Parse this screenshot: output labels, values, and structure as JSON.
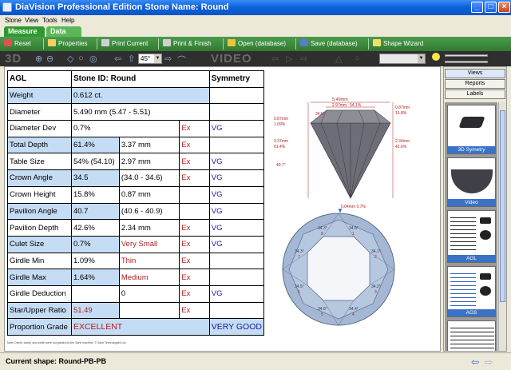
{
  "window": {
    "title": "DiaVision Professional Edition Stone Name: Round"
  },
  "menu": [
    "Stone",
    "View",
    "Tools",
    "Help"
  ],
  "tabs": [
    "Measure",
    "Data"
  ],
  "toolbar": {
    "reset": "Reset",
    "properties": "Properties",
    "print_current": "Print Current",
    "print_finish": "Print & Finish",
    "open_database": "Open (database)",
    "save_database": "Save (database)",
    "shape_wizard": "Shape Wizard"
  },
  "view_bar": {
    "label_3d": "3D",
    "label_video": "VIDEO",
    "angle": "45°"
  },
  "report": {
    "lab": "AGL",
    "stone_id": "Stone ID: Round",
    "symmetry_header": "Symmetry",
    "rows": [
      {
        "label": "Weight",
        "value": "0.612 ct.",
        "detail": "",
        "grade": "",
        "symmetry": ""
      },
      {
        "label": "Diameter",
        "value": "5.490 mm (5.47 - 5.51)",
        "detail": "",
        "grade": "",
        "symmetry": ""
      },
      {
        "label": "Diameter Dev",
        "value": "0.7%",
        "detail": "",
        "grade": "Ex",
        "symmetry": "VG"
      },
      {
        "label": "Total Depth",
        "value": "61.4%",
        "detail": "3.37 mm",
        "grade": "Ex",
        "symmetry": ""
      },
      {
        "label": "Table Size",
        "value": "54% (54.10)",
        "detail": "2.97 mm",
        "grade": "Ex",
        "symmetry": "VG"
      },
      {
        "label": "Crown Angle",
        "value": "34.5",
        "detail": "(34.0 - 34.6)",
        "grade": "Ex",
        "symmetry": "VG"
      },
      {
        "label": "Crown Height",
        "value": "15.8%",
        "detail": "0.87 mm",
        "grade": "",
        "symmetry": "VG"
      },
      {
        "label": "Pavilion Angle",
        "value": "40.7",
        "detail": "(40.6 - 40.9)",
        "grade": "",
        "symmetry": "VG"
      },
      {
        "label": "Pavilion Depth",
        "value": "42.6%",
        "detail": "2.34 mm",
        "grade": "Ex",
        "symmetry": "VG"
      },
      {
        "label": "Culet Size",
        "value": "0.7%",
        "detail": "Very Small",
        "grade": "Ex",
        "symmetry": "VG"
      },
      {
        "label": "Girdle Min",
        "value": "1.09%",
        "detail": "Thin",
        "grade": "Ex",
        "symmetry": ""
      },
      {
        "label": "Girdle Max",
        "value": "1.64%",
        "detail": "Medium",
        "grade": "Ex",
        "symmetry": ""
      },
      {
        "label": "Girdle Deduction",
        "value": "",
        "detail": "0",
        "grade": "Ex",
        "symmetry": "VG"
      },
      {
        "label": "Star/Upper Ratio",
        "value": "51.49",
        "detail": "",
        "grade": "Ex",
        "symmetry": ""
      },
      {
        "label": "Proportion Grade",
        "value": "EXCELLENT",
        "detail": "",
        "grade": "",
        "symmetry": "VERY GOOD"
      }
    ],
    "footnote": "Note: Depth, clarity, and polish were not graded by the Sarin machine. © Sarin Technologies Ltd."
  },
  "profile": {
    "width": "5.49mm",
    "table": "2.97mm",
    "table_pct": "54.1%",
    "crown_angle": "34.5°",
    "crown_height_mm": "0.87mm",
    "crown_height_pct": "15.8%",
    "crown_left_mm": "0.87mm",
    "crown_left_pct": "1.09%",
    "depth_mm": "3.37mm",
    "depth_pct": "61.4%",
    "pav_depth_mm": "2.34mm",
    "pav_depth_pct": "42.6%",
    "pav_angle": "40.7°",
    "culet": "0.04mm 0.7%"
  },
  "top_view": {
    "crown_angles": [
      "34.3°",
      "34.6°",
      "34.1°",
      "34.2°",
      "34.4°",
      "34.6°",
      "34.5°",
      "34.3°"
    ],
    "numbers": [
      "8",
      "1",
      "2",
      "3",
      "4",
      "5",
      "6",
      "7"
    ]
  },
  "sidebar": {
    "buttons": [
      "Views",
      "Reports",
      "Labels"
    ],
    "thumbnails": [
      "3D Symetry",
      "Video",
      "AGL",
      "AGS",
      ""
    ]
  },
  "status": {
    "text": "Current shape: Round-PB-PB"
  },
  "colors": {
    "title_bar": "#0a5fd8",
    "toolbar_green": "#3c8a3c",
    "cell_blue": "#c5dcf5",
    "accent_red": "#b02020"
  }
}
